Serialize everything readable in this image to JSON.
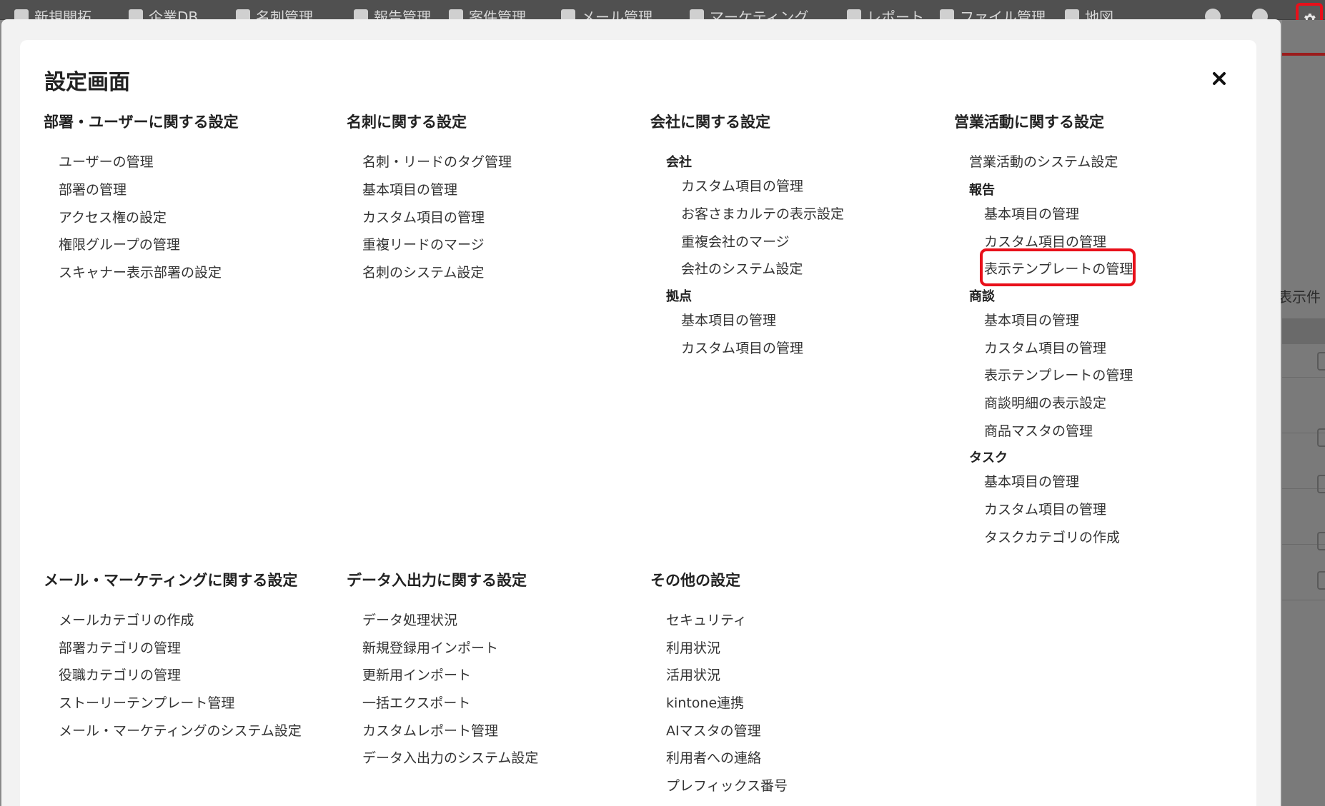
{
  "topnav": {
    "items": [
      "新規開拓",
      "企業DB",
      "名刺管理",
      "報告管理",
      "案件管理",
      "メール管理",
      "マーケティング",
      "レポート",
      "ファイル管理",
      "地図"
    ]
  },
  "background": {
    "display_count_label": "表示件"
  },
  "modal": {
    "title": "設定画面",
    "close_icon": "close-icon",
    "sections": {
      "dept_user": {
        "title": "部署・ユーザーに関する設定",
        "items": [
          "ユーザーの管理",
          "部署の管理",
          "アクセス権の設定",
          "権限グループの管理",
          "スキャナー表示部署の設定"
        ]
      },
      "business_card": {
        "title": "名刺に関する設定",
        "items": [
          "名刺・リードのタグ管理",
          "基本項目の管理",
          "カスタム項目の管理",
          "重複リードのマージ",
          "名刺のシステム設定"
        ]
      },
      "company": {
        "title": "会社に関する設定",
        "company_head": "会社",
        "company_items": [
          "カスタム項目の管理",
          "お客さまカルテの表示設定",
          "重複会社のマージ",
          "会社のシステム設定"
        ],
        "branch_head": "拠点",
        "branch_items": [
          "基本項目の管理",
          "カスタム項目の管理"
        ]
      },
      "sales": {
        "title": "営業活動に関する設定",
        "system": "営業活動のシステム設定",
        "report_head": "報告",
        "report_items": [
          "基本項目の管理",
          "カスタム項目の管理",
          "表示テンプレートの管理"
        ],
        "deal_head": "商談",
        "deal_items": [
          "基本項目の管理",
          "カスタム項目の管理",
          "表示テンプレートの管理",
          "商談明細の表示設定",
          "商品マスタの管理"
        ],
        "task_head": "タスク",
        "task_items": [
          "基本項目の管理",
          "カスタム項目の管理",
          "タスクカテゴリの作成"
        ]
      },
      "mail_marketing": {
        "title": "メール・マーケティングに関する設定",
        "items": [
          "メールカテゴリの作成",
          "部署カテゴリの管理",
          "役職カテゴリの管理",
          "ストーリーテンプレート管理",
          "メール・マーケティングのシステム設定"
        ]
      },
      "data_io": {
        "title": "データ入出力に関する設定",
        "items": [
          "データ処理状況",
          "新規登録用インポート",
          "更新用インポート",
          "一括エクスポート",
          "カスタムレポート管理",
          "データ入出力のシステム設定"
        ]
      },
      "other": {
        "title": "その他の設定",
        "items": [
          "セキュリティ",
          "利用状況",
          "活用状況",
          "kintone連携",
          "AIマスタの管理",
          "利用者への連絡",
          "プレフィックス番号"
        ]
      }
    }
  },
  "colors": {
    "highlight": "#e8101a",
    "overlay": "#8a8a8a",
    "modal_bg": "#ffffff"
  }
}
